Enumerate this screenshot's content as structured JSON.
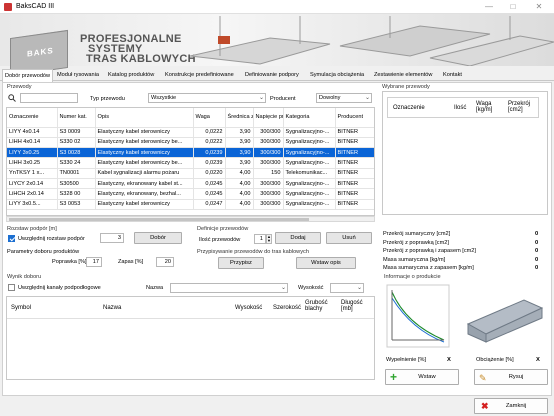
{
  "window": {
    "title": "BaksCAD III"
  },
  "banner": {
    "line1": "PROFESJONALNE",
    "line2": "SYSTEMY",
    "line3": "TRAS KABLOWYCH",
    "logo_text": "BAKS"
  },
  "tabs": [
    "Dobór przewodów",
    "Moduł rysowania",
    "Katalog produktów",
    "Konstrukcje predefiniowane",
    "Definiowanie podpory",
    "Symulacja obciążenia",
    "Zestawienie elementów",
    "Kontakt"
  ],
  "przewody": {
    "group_label": "Przewody",
    "search_value": "",
    "typ_label": "Typ przewodu",
    "typ_value": "Wszystkie",
    "producent_label": "Producent",
    "producent_value": "Dowolny",
    "columns": [
      "Oznaczenie",
      "Numer kat.",
      "Opis",
      "Waga",
      "Średnica zew.",
      "Napięcie pracy",
      "Kategoria",
      "Producent"
    ],
    "rows": [
      [
        "LIYY 4x0.14",
        "S3 0009",
        "Elastyczny kabel sterowniczy",
        "0,0222",
        "3,90",
        "300/300",
        "Sygnalizacyjno-...",
        "BITNER"
      ],
      [
        "LIHH 4x0.14",
        "S330 02",
        "Elastyczny kabel sterowniczy be...",
        "0,0222",
        "3,90",
        "300/300",
        "Sygnalizacyjno-...",
        "BITNER"
      ],
      [
        "LIYY 3x0.25",
        "S3 0028",
        "Elastyczny kabel sterowniczy",
        "0,0239",
        "3,90",
        "300/300",
        "Sygnalizacyjno-...",
        "BITNER"
      ],
      [
        "LIHH 3x0.25",
        "S330 24",
        "Elastyczny kabel sterowniczy be...",
        "0,0239",
        "3,90",
        "300/300",
        "Sygnalizacyjno-...",
        "BITNER"
      ],
      [
        "YnTKSY 1 x...",
        "TN0001",
        "Kabel sygnalizacji alarmu pożaru",
        "0,0220",
        "4,00",
        "150",
        "Telekomunikac...",
        "BITNER"
      ],
      [
        "LiYCY 2x0.14",
        "S30500",
        "Elastyczny, ekranowany kabel st...",
        "0,0245",
        "4,00",
        "300/300",
        "Sygnalizacyjno-...",
        "BITNER"
      ],
      [
        "LiHCH 2x0.14",
        "S328 00",
        "Elastyczny, ekranowany, bezhal...",
        "0,0245",
        "4,00",
        "300/300",
        "Sygnalizacyjno-...",
        "BITNER"
      ],
      [
        "LiYY 3x0.5...",
        "S3 0053",
        "Elastyczny kabel sterowniczy",
        "0,0247",
        "4,00",
        "300/300",
        "Sygnalizacyjno-...",
        "BITNER"
      ]
    ],
    "selected_row": 2
  },
  "wybrane": {
    "group_label": "Wybrane przewody",
    "columns": [
      "Oznaczenie",
      "Ilość",
      "Waga [kg/m]",
      "Przekrój [cm2]"
    ]
  },
  "rozstaw": {
    "group_label": "Rozstaw podpór [m]",
    "checkbox_label": "Uwzględnij rozstaw podpór",
    "value": "3",
    "button": "Dobór",
    "params_label": "Parametry doboru produktów",
    "poprawka_label": "Poprawka [%]",
    "poprawka_value": "17",
    "zapas_label": "Zapas [%]",
    "zapas_value": "20"
  },
  "definicje": {
    "group_label": "Definicje przewodów",
    "ilosc_label": "Ilość przewodów",
    "ilosc_value": "1",
    "dodaj": "Dodaj",
    "usun": "Usuń"
  },
  "przypisywanie": {
    "group_label": "Przypisywanie przewodów do tras kablowych",
    "przypisz": "Przypisz",
    "wstaw_opis": "Wstaw opis"
  },
  "sums": [
    {
      "label": "Przekrój sumaryczny [cm2]",
      "value": "0"
    },
    {
      "label": "Przekrój z poprawką [cm2]",
      "value": "0"
    },
    {
      "label": "Przekrój z poprawką i zapasem [cm2]",
      "value": "0"
    },
    {
      "label": "Masa sumaryczna [kg/m]",
      "value": "0"
    },
    {
      "label": "Masa sumaryczna z zapasem [kg/m]",
      "value": "0"
    }
  ],
  "wynik": {
    "group_label": "Wynik doboru",
    "checkbox_label": "Uwzględnij kanały podpodłogowe",
    "nazwa_label": "Nazwa",
    "nazwa_value": "",
    "wysokosc_label": "Wysokość",
    "wysokosc_value": "",
    "columns": [
      "Symbol",
      "Nazwa",
      "Wysokość",
      "Szerokość",
      "Grubość blachy",
      "Długość [mb]"
    ]
  },
  "info": {
    "group_label": "Informacje o produkcie",
    "wypelnienie_label": "Wypełnienie [%]",
    "wypelnienie_value": "X",
    "obciazenie_label": "Obciążenie [%]",
    "obciazenie_value": "X",
    "wstaw": "Wstaw",
    "rysuj": "Rysuj"
  },
  "zamknij": "Zamknij",
  "colors": {
    "selection": "#0a64d6",
    "accent_green": "#2fa52f",
    "close_red": "#d42020"
  }
}
